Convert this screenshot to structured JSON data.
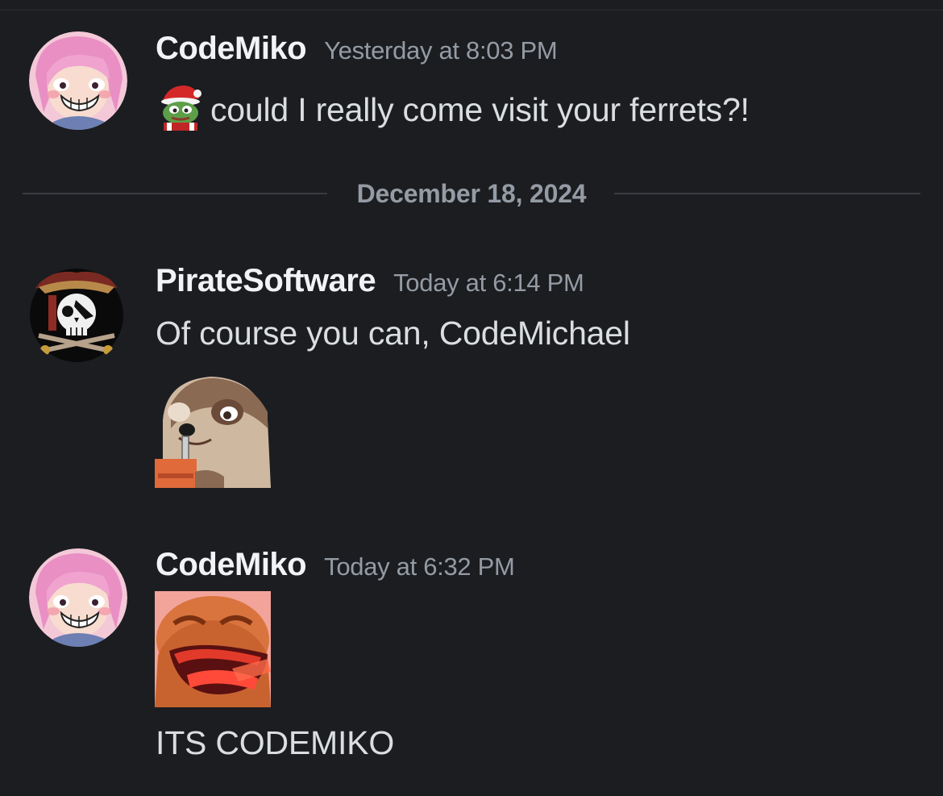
{
  "colors": {
    "background": "#1c1d21",
    "username": "#f2f3f5",
    "timestamp": "#949ba4",
    "message_text": "#dbdee1",
    "divider": "#3a3c42"
  },
  "messages": [
    {
      "author": "CodeMiko",
      "timestamp": "Yesterday at 8:03 PM",
      "avatar": "codemiko-avatar",
      "inline_emoji": "pepe-santa-emoji",
      "text": "could I really come visit your ferrets?!"
    },
    {
      "author": "PirateSoftware",
      "timestamp": "Today at 6:14 PM",
      "avatar": "pirate-skull-avatar",
      "text": "Of course you can, CodeMichael",
      "sticker": "ferret-juicebox-emoji"
    },
    {
      "author": "CodeMiko",
      "timestamp": "Today at 6:32 PM",
      "avatar": "codemiko-avatar",
      "sticker": "pepe-rage-emoji",
      "text": "ITS CODEMIKO"
    }
  ],
  "date_divider": "December 18, 2024"
}
